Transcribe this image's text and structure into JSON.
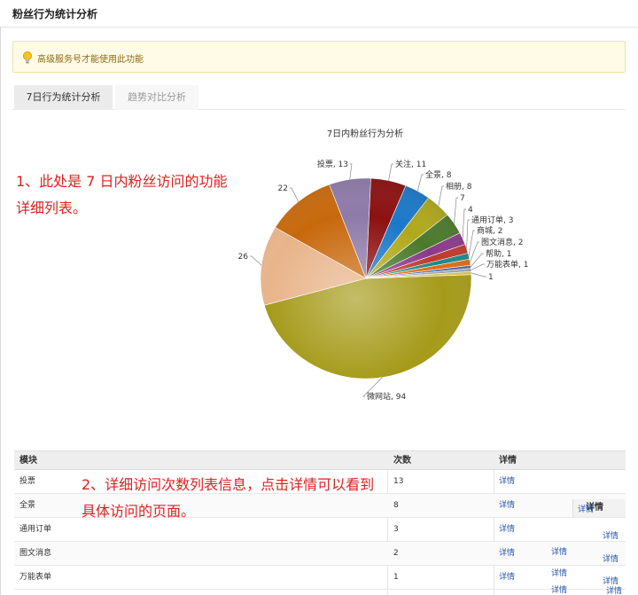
{
  "header": {
    "title": "粉丝行为统计分析"
  },
  "notice": {
    "text": "高级服务号才能使用此功能"
  },
  "tabs": [
    {
      "label": "7日行为统计分析",
      "active": true
    },
    {
      "label": "趋势对比分析",
      "active": false
    }
  ],
  "annotations": {
    "first": "1、此处是 7 日内粉丝访问的功能详细列表。",
    "second": "2、详细访问次数列表信息，点击详情可以看到具体访问的页面。"
  },
  "chart_data": {
    "type": "pie",
    "title": "7日内粉丝行为分析",
    "slices": [
      {
        "label": "微网站",
        "value": 94,
        "color": "#a59a19"
      },
      {
        "label": "",
        "value": 26,
        "color": "#e8b48a"
      },
      {
        "label": "",
        "value": 22,
        "color": "#c8680c"
      },
      {
        "label": "投票",
        "value": 13,
        "color": "#8e7aa8"
      },
      {
        "label": "关注",
        "value": 11,
        "color": "#8c1010"
      },
      {
        "label": "全景",
        "value": 8,
        "color": "#1a78c8"
      },
      {
        "label": "相册",
        "value": 8,
        "color": "#b0a81a"
      },
      {
        "label": "",
        "value": 7,
        "color": "#4a7a2a"
      },
      {
        "label": "",
        "value": 4,
        "color": "#8a3a8a"
      },
      {
        "label": "通用订单",
        "value": 3,
        "color": "#c0392b"
      },
      {
        "label": "商城",
        "value": 2,
        "color": "#1a8a8a"
      },
      {
        "label": "图文消息",
        "value": 2,
        "color": "#e06a10"
      },
      {
        "label": "帮助",
        "value": 1,
        "color": "#4a6aa8"
      },
      {
        "label": "万能表单",
        "value": 1,
        "color": "#9aa0a8"
      },
      {
        "label": "",
        "value": 1,
        "color": "#d8c060"
      }
    ]
  },
  "table": {
    "headers": [
      "模块",
      "次数",
      "详情"
    ],
    "rows": [
      {
        "module": "投票",
        "count": "13",
        "detail": "详情"
      },
      {
        "module": "全景",
        "count": "8",
        "detail": "详情"
      },
      {
        "module": "通用订单",
        "count": "3",
        "detail": "详情"
      },
      {
        "module": "图文消息",
        "count": "2",
        "detail": "详情"
      },
      {
        "module": "万能表单",
        "count": "1",
        "detail": "详情"
      }
    ]
  },
  "overlay": {
    "header": "详情",
    "links": [
      "详情",
      "详情",
      "详情",
      "详情",
      "详情",
      "详情",
      "详情",
      "详情"
    ]
  }
}
